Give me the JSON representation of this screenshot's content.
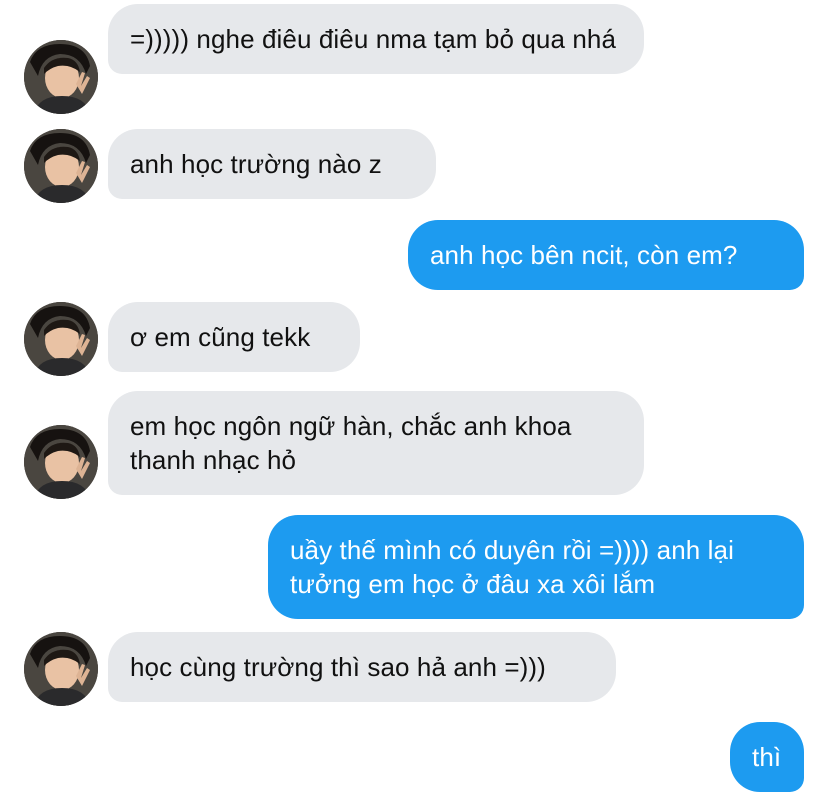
{
  "conversation": {
    "messages": [
      {
        "sender": "other",
        "text": "=))))) nghe điêu điêu nma tạm bỏ qua nhá"
      },
      {
        "sender": "other",
        "text": "anh học trường nào z"
      },
      {
        "sender": "me",
        "text": "anh học bên ncit, còn em?"
      },
      {
        "sender": "other",
        "text": "ơ em cũng tekk"
      },
      {
        "sender": "other",
        "text": "em học ngôn ngữ hàn, chắc anh khoa thanh nhạc hỏ"
      },
      {
        "sender": "me",
        "text": "uầy thế mình có duyên rồi =)))) anh lại tưởng em học ở đâu xa xôi lắm"
      },
      {
        "sender": "other",
        "text": "học cùng trường thì sao hả anh =)))"
      },
      {
        "sender": "me",
        "text": "thì"
      }
    ]
  },
  "colors": {
    "incoming_bubble": "#e6e8eb",
    "outgoing_bubble": "#1d9bf0",
    "incoming_text": "#111111",
    "outgoing_text": "#ffffff"
  },
  "icons": {
    "avatar": "contact-avatar-photo"
  }
}
